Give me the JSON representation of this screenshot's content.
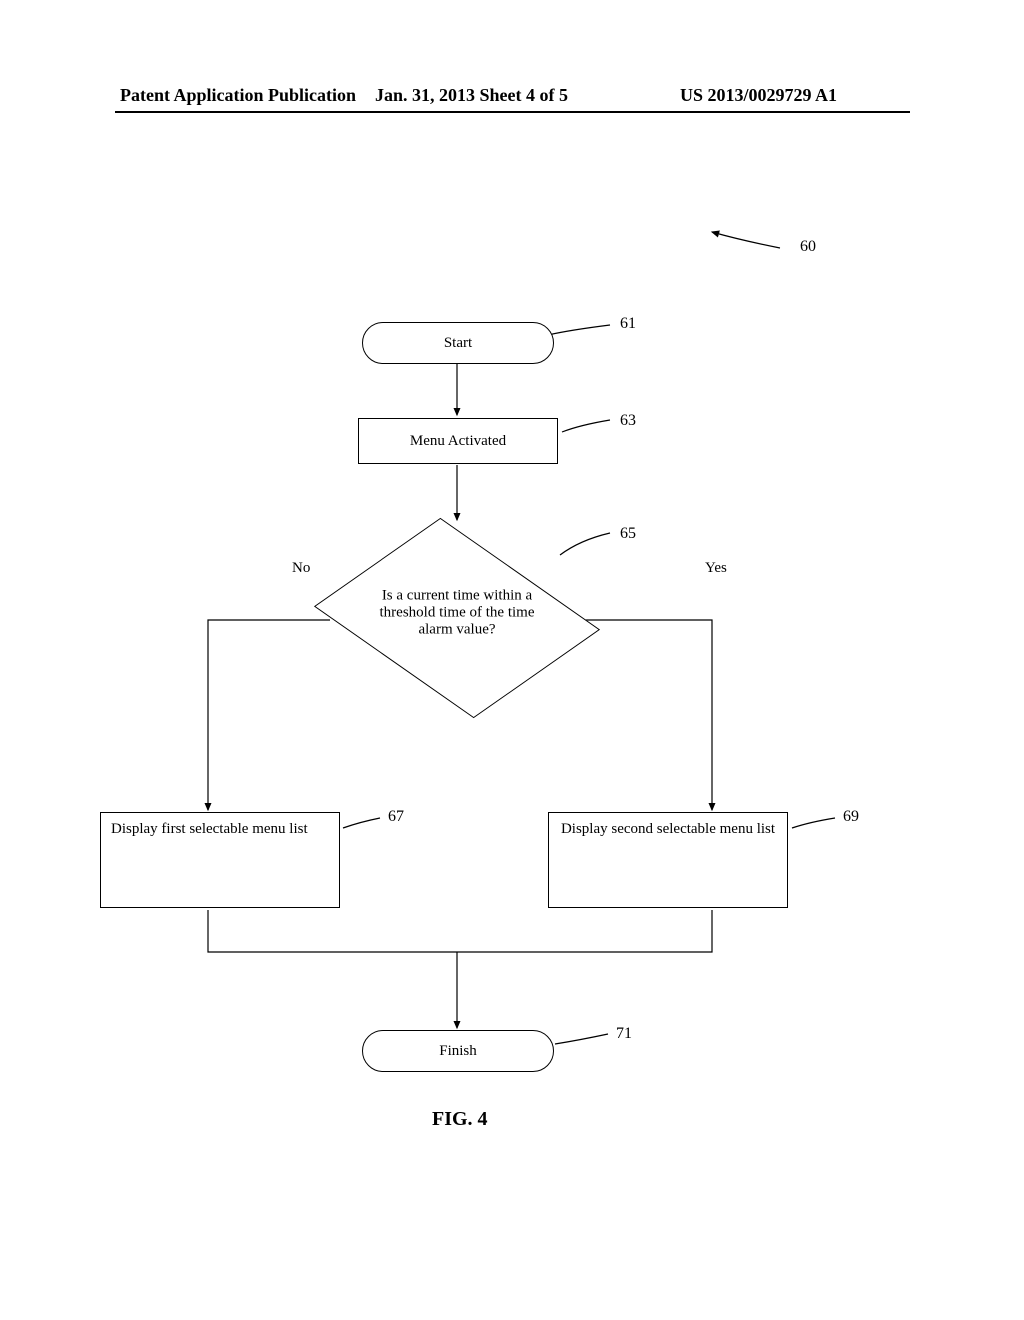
{
  "header": {
    "left": "Patent Application Publication",
    "center": "Jan. 31, 2013  Sheet 4 of 5",
    "right": "US 2013/0029729 A1"
  },
  "figure_label": "FIG. 4",
  "refs": {
    "r60": "60",
    "r61": "61",
    "r63": "63",
    "r65": "65",
    "r67": "67",
    "r69": "69",
    "r71": "71"
  },
  "nodes": {
    "start": "Start",
    "menu_activated": "Menu Activated",
    "decision": "Is a current time within a threshold time of the time alarm value?",
    "first_list": "Display first selectable menu list",
    "second_list": "Display second selectable menu list",
    "finish": "Finish"
  },
  "edges": {
    "no": "No",
    "yes": "Yes"
  }
}
